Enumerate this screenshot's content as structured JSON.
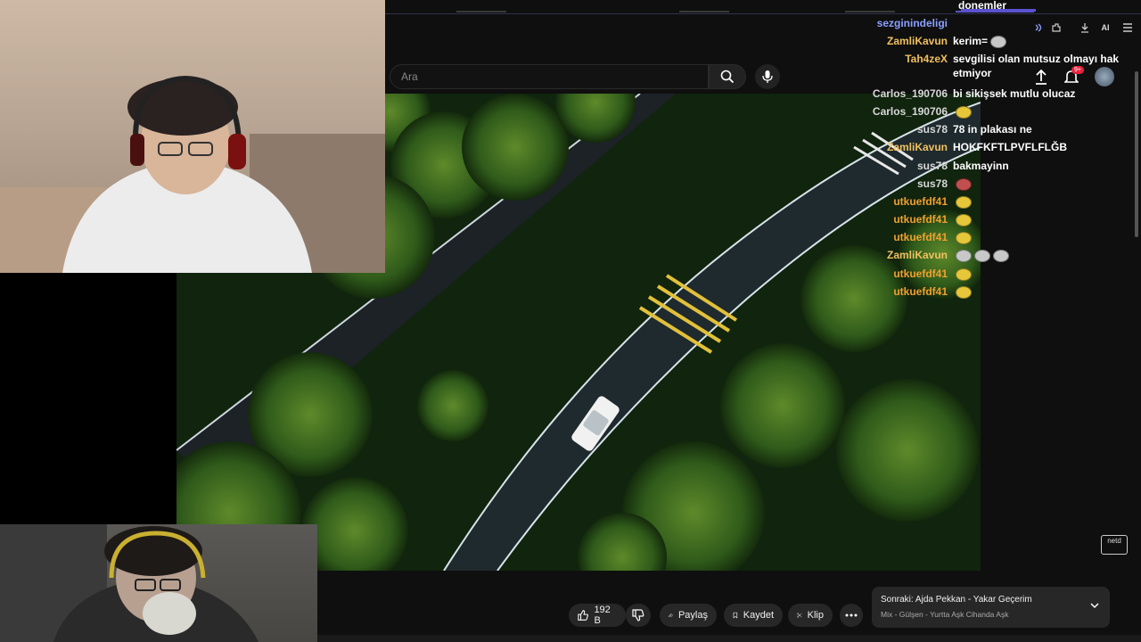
{
  "search": {
    "placeholder": "Ara"
  },
  "chat": {
    "top_fragment": "donemler",
    "lines": [
      {
        "user": "sezginindeligi",
        "color": "#8aa0ff",
        "msg": ""
      },
      {
        "user": "ZamliKavun",
        "color": "#f0c060",
        "msg": "kerim="
      },
      {
        "user": "Tah4zeX",
        "color": "#f0c060",
        "msg": "sevgilisi olan mutsuz olmayı hak etmiyor"
      },
      {
        "user": "Carlos_190706",
        "color": "#d8d8d8",
        "msg": "bi sikişsek mutlu olucaz"
      },
      {
        "user": "Carlos_190706",
        "color": "#d8d8d8",
        "msg": ""
      },
      {
        "user": "sus78",
        "color": "#d8d8d8",
        "msg": "78 in plakası ne"
      },
      {
        "user": "ZamliKavun",
        "color": "#f0c060",
        "msg": "HOKFKFTLPVFLFLĞB"
      },
      {
        "user": "sus78",
        "color": "#d8d8d8",
        "msg": "bakmayinn"
      },
      {
        "user": "sus78",
        "color": "#d8d8d8",
        "msg": ""
      },
      {
        "user": "utkuefdf41",
        "color": "#f0a030",
        "msg": ""
      },
      {
        "user": "utkuefdf41",
        "color": "#f0a030",
        "msg": ""
      },
      {
        "user": "utkuefdf41",
        "color": "#f0a030",
        "msg": ""
      },
      {
        "user": "ZamliKavun",
        "color": "#f0c060",
        "msg": ""
      },
      {
        "user": "utkuefdf41",
        "color": "#f0a030",
        "msg": ""
      },
      {
        "user": "utkuefdf41",
        "color": "#f0a030",
        "msg": ""
      }
    ]
  },
  "header": {
    "notifications_badge": "9+",
    "ai_label": "AI"
  },
  "actions": {
    "like_count": "192 B",
    "share": "Paylaş",
    "save": "Kaydet",
    "clip": "Klip"
  },
  "next_card": {
    "prefix": "Sonraki:",
    "title": "Ajda Pekkan - Yakar Geçerim",
    "subtitle": "Mix - Gülşen - Yurtta Aşk Cihanda Aşk"
  },
  "watermark": "netd",
  "colors": {
    "background": "#0f0f0f",
    "pill": "#272727",
    "badge": "#e6223c"
  }
}
